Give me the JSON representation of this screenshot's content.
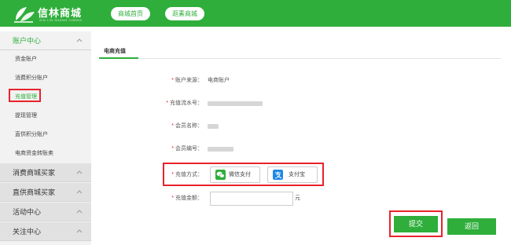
{
  "header": {
    "logo_text": "信林商城",
    "logo_subtext": "XIN LIN SHANG CHENG",
    "nav": [
      "商城首页",
      "逛素商城"
    ]
  },
  "sidebar": {
    "groups": [
      {
        "label": "账户中心",
        "expanded": true,
        "items": [
          "资金账户",
          "消费积分账户",
          "充值管理",
          "提现管理",
          "直供积分账户",
          "电商资金转账卖"
        ]
      },
      {
        "label": "消费商城买家"
      },
      {
        "label": "直供商城买家"
      },
      {
        "label": "活动中心"
      },
      {
        "label": "关注中心"
      }
    ],
    "current_item": "充值管理"
  },
  "main": {
    "tab": "电商充值",
    "fields": [
      {
        "label": "账户来源：",
        "value": "电商账户"
      },
      {
        "label": "充值流水号：",
        "value": ""
      },
      {
        "label": "会员名称：",
        "value": ""
      },
      {
        "label": "会员编号：",
        "value": ""
      },
      {
        "label": "充值方式：",
        "value": ""
      },
      {
        "label": "充值金额：",
        "value": ""
      }
    ],
    "required_mark": "*",
    "payment_methods": [
      "微信支付",
      "支付宝"
    ],
    "amount_placeholder": "",
    "unit": "元",
    "submit": "提交",
    "back": "返回"
  },
  "colors": {
    "brand_green": "#2fae3b",
    "highlight_red": "#e8232b"
  }
}
